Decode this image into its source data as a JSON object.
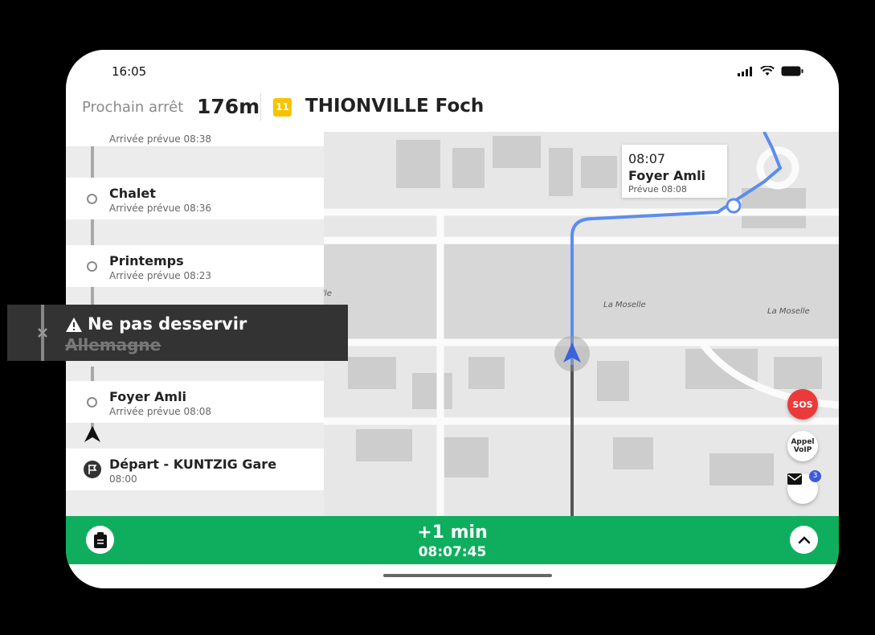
{
  "status_bar": {
    "time": "16:05"
  },
  "header": {
    "next_stop_label": "Prochain arrêt",
    "distance": "176m",
    "line_number": "11",
    "stop_name": "THIONVILLE Foch"
  },
  "stops": [
    {
      "name": "",
      "arrival": "Arrivée prévue 08:38"
    },
    {
      "name": "Chalet",
      "arrival": "Arrivée prévue 08:36"
    },
    {
      "name": "Printemps",
      "arrival": "Arrivée prévue 08:23"
    },
    {
      "name": "Foyer Amli",
      "arrival": "Arrivée prévue 08:08"
    },
    {
      "name": "Départ - KUNTZIG Gare",
      "arrival": "08:00"
    }
  ],
  "warning": {
    "title": "Ne pas desservir",
    "stop": "Allemagne"
  },
  "map": {
    "callout": {
      "time": "08:07",
      "name": "Foyer Amli",
      "planned": "Prévue 08:08"
    },
    "labels": [
      "La Moselle",
      "La Moselle",
      "elle"
    ],
    "route_color": "#5b8def"
  },
  "actions": {
    "sos": "SOS",
    "voip_line1": "Appel",
    "voip_line2": "VoIP",
    "messages_count": "3"
  },
  "bottom_bar": {
    "delay": "+1 min",
    "clock": "08:07:45",
    "color": "#0fae5e"
  }
}
